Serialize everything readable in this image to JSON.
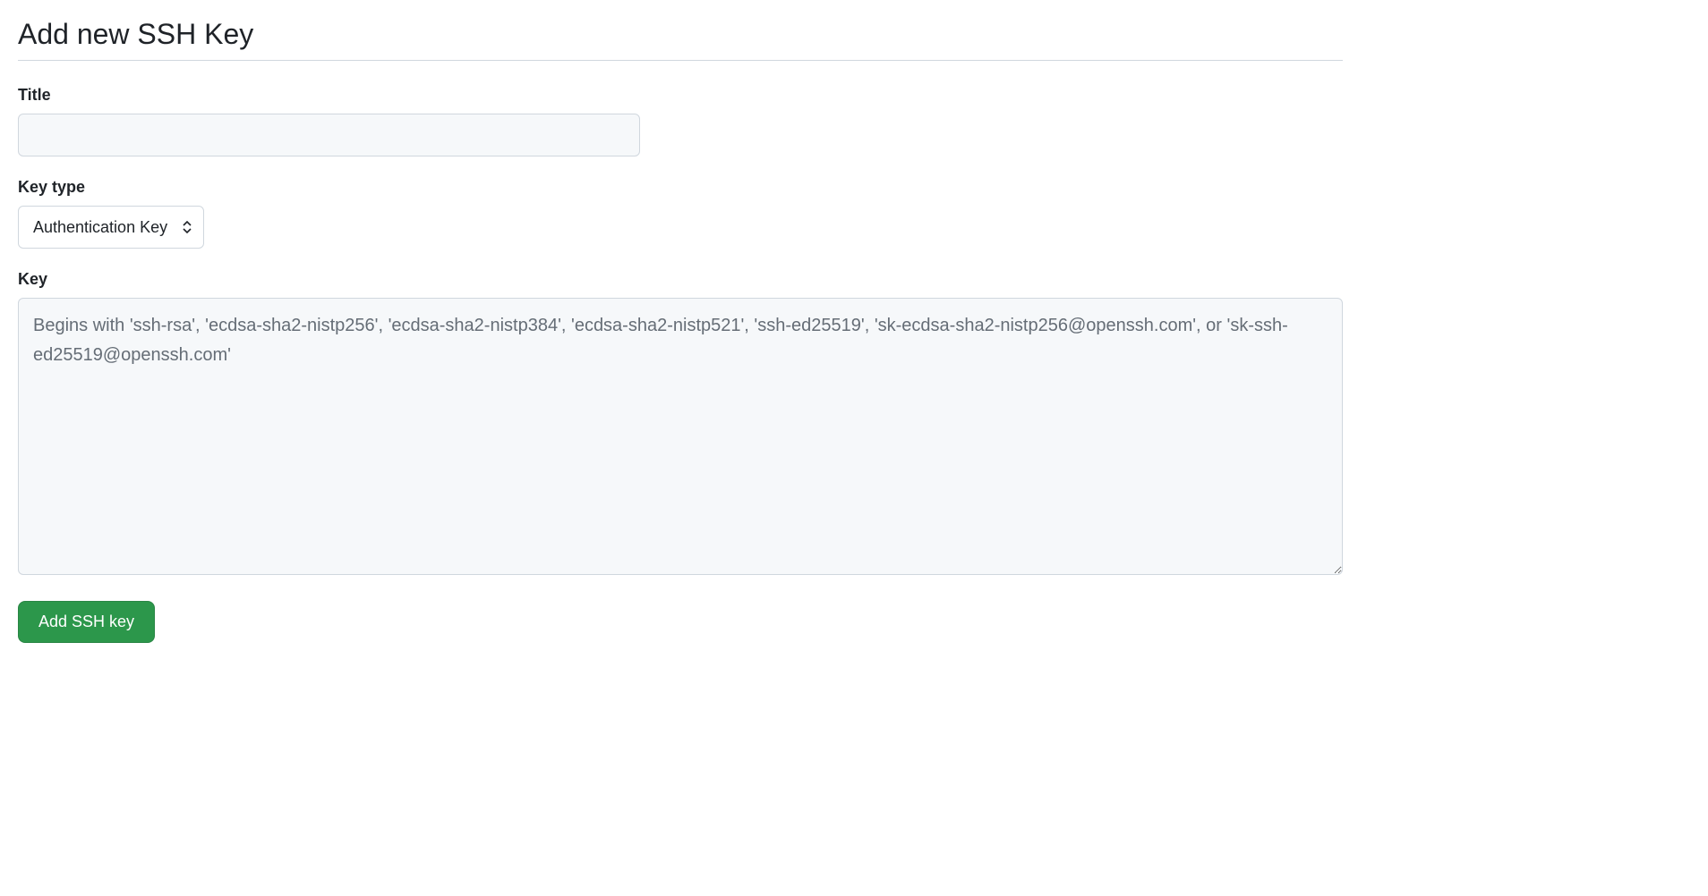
{
  "page": {
    "title": "Add new SSH Key"
  },
  "form": {
    "title": {
      "label": "Title",
      "value": ""
    },
    "key_type": {
      "label": "Key type",
      "selected": "Authentication Key"
    },
    "key": {
      "label": "Key",
      "value": "",
      "placeholder": "Begins with 'ssh-rsa', 'ecdsa-sha2-nistp256', 'ecdsa-sha2-nistp384', 'ecdsa-sha2-nistp521', 'ssh-ed25519', 'sk-ecdsa-sha2-nistp256@openssh.com', or 'sk-ssh-ed25519@openssh.com'"
    },
    "submit_label": "Add SSH key"
  }
}
